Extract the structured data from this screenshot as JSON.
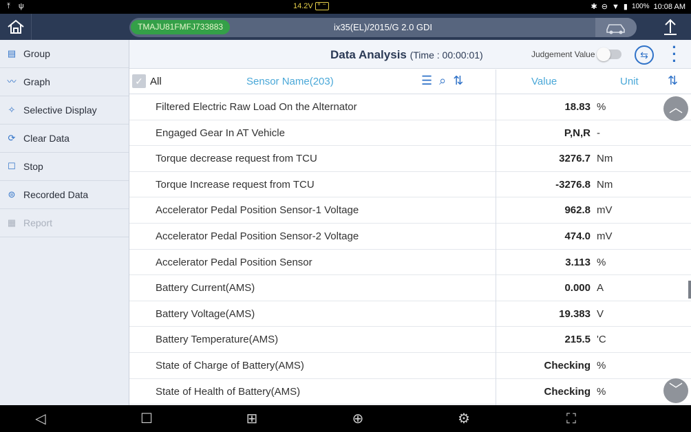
{
  "status": {
    "left_icons": [
      "upload-arrow-icon",
      "usb-icon"
    ],
    "voltage": "14.2V",
    "battery_pct": "100%",
    "time": "10:08 AM"
  },
  "topbar": {
    "vin": "TMAJU81FMFJ733883",
    "vehicle": "ix35(EL)/2015/G 2.0 GDI"
  },
  "sidebar": {
    "items": [
      {
        "label": "Group",
        "icon": "group-icon",
        "enabled": true
      },
      {
        "label": "Graph",
        "icon": "graph-icon",
        "enabled": true
      },
      {
        "label": "Selective Display",
        "icon": "pin-icon",
        "enabled": true
      },
      {
        "label": "Clear Data",
        "icon": "clear-icon",
        "enabled": true
      },
      {
        "label": "Stop",
        "icon": "stop-icon",
        "enabled": true
      },
      {
        "label": "Recorded Data",
        "icon": "recorded-icon",
        "enabled": true
      },
      {
        "label": "Report",
        "icon": "report-icon",
        "enabled": false
      }
    ]
  },
  "header": {
    "title": "Data Analysis",
    "time": "(Time : 00:00:01)",
    "judgement_label": "Judgement Value"
  },
  "columns": {
    "all": "All",
    "sensor": "Sensor Name(203)",
    "value": "Value",
    "unit": "Unit"
  },
  "rows": [
    {
      "name": "Filtered Electric Raw Load On the Alternator",
      "value": "18.83",
      "unit": "%"
    },
    {
      "name": "Engaged Gear In AT Vehicle",
      "value": "P,N,R",
      "unit": "-"
    },
    {
      "name": "Torque decrease request from TCU",
      "value": "3276.7",
      "unit": "Nm"
    },
    {
      "name": "Torque Increase request from TCU",
      "value": "-3276.8",
      "unit": "Nm"
    },
    {
      "name": "Accelerator Pedal Position Sensor-1 Voltage",
      "value": "962.8",
      "unit": "mV"
    },
    {
      "name": "Accelerator Pedal Position Sensor-2 Voltage",
      "value": "474.0",
      "unit": "mV"
    },
    {
      "name": "Accelerator Pedal Position Sensor",
      "value": "3.113",
      "unit": "%"
    },
    {
      "name": "Battery Current(AMS)",
      "value": "0.000",
      "unit": "A"
    },
    {
      "name": "Battery Voltage(AMS)",
      "value": "19.383",
      "unit": "V"
    },
    {
      "name": "Battery Temperature(AMS)",
      "value": "215.5",
      "unit": "'C"
    },
    {
      "name": "State of Charge of Battery(AMS)",
      "value": "Checking",
      "unit": "%"
    },
    {
      "name": "State of Health of Battery(AMS)",
      "value": "Checking",
      "unit": "%"
    }
  ],
  "colors": {
    "accent": "#2f72c8",
    "header_bg": "#2b3a55",
    "vin_badge": "#34a048",
    "column_header_text": "#4aa8d8"
  }
}
